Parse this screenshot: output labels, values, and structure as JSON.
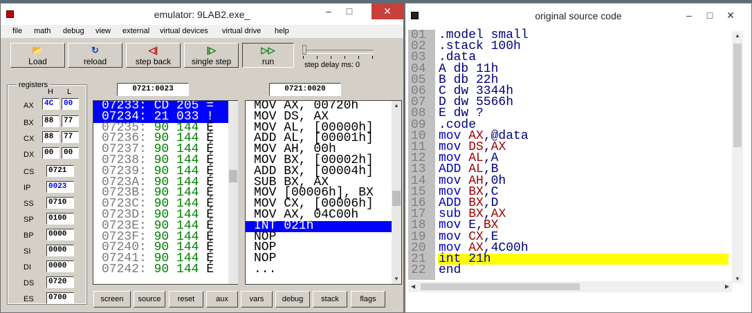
{
  "emulator": {
    "title": "emulator: 9LAB2.exe_",
    "window_controls": {
      "minimize": "–",
      "maximize": "□",
      "close": "✕"
    },
    "menu": [
      "file",
      "math",
      "debug",
      "view",
      "external",
      "virtual devices",
      "virtual drive",
      "help"
    ],
    "toolbar": {
      "buttons": [
        {
          "label": "Load",
          "icon": "folder-open-icon",
          "glyph": "📂"
        },
        {
          "label": "reload",
          "icon": "reload-icon",
          "glyph": "↻"
        },
        {
          "label": "step back",
          "icon": "step-back-icon",
          "glyph": "◁|"
        },
        {
          "label": "single step",
          "icon": "single-step-icon",
          "glyph": "|▷"
        },
        {
          "label": "run",
          "icon": "run-icon",
          "glyph": "▷▷"
        }
      ],
      "step_delay_label": "step delay ms: 0"
    },
    "registers": {
      "legend": "registers",
      "col_h": "H",
      "col_l": "L",
      "split": [
        {
          "name": "AX",
          "h": "4C",
          "l": "00"
        },
        {
          "name": "BX",
          "h": "88",
          "l": "77"
        },
        {
          "name": "CX",
          "h": "88",
          "l": "77"
        },
        {
          "name": "DX",
          "h": "00",
          "l": "00"
        }
      ],
      "full": [
        {
          "name": "CS",
          "value": "0721"
        },
        {
          "name": "IP",
          "value": "0023"
        },
        {
          "name": "SS",
          "value": "0710"
        },
        {
          "name": "SP",
          "value": "0100"
        },
        {
          "name": "BP",
          "value": "0000"
        },
        {
          "name": "SI",
          "value": "0000"
        },
        {
          "name": "DI",
          "value": "0000"
        },
        {
          "name": "DS",
          "value": "0720"
        },
        {
          "name": "ES",
          "value": "0700"
        }
      ]
    },
    "memory_address": "0721:0023",
    "disasm_address": "0721:0020",
    "memory_rows": [
      {
        "addr": "07233:",
        "hex": "CD",
        "dec": "205",
        "ch": "="
      },
      {
        "addr": "07234:",
        "hex": "21",
        "dec": "033",
        "ch": "!"
      },
      {
        "addr": "07235:",
        "hex": "90",
        "dec": "144",
        "ch": "É"
      },
      {
        "addr": "07236:",
        "hex": "90",
        "dec": "144",
        "ch": "É"
      },
      {
        "addr": "07237:",
        "hex": "90",
        "dec": "144",
        "ch": "É"
      },
      {
        "addr": "07238:",
        "hex": "90",
        "dec": "144",
        "ch": "É"
      },
      {
        "addr": "07239:",
        "hex": "90",
        "dec": "144",
        "ch": "É"
      },
      {
        "addr": "0723A:",
        "hex": "90",
        "dec": "144",
        "ch": "É"
      },
      {
        "addr": "0723B:",
        "hex": "90",
        "dec": "144",
        "ch": "É"
      },
      {
        "addr": "0723C:",
        "hex": "90",
        "dec": "144",
        "ch": "É"
      },
      {
        "addr": "0723D:",
        "hex": "90",
        "dec": "144",
        "ch": "É"
      },
      {
        "addr": "0723E:",
        "hex": "90",
        "dec": "144",
        "ch": "É"
      },
      {
        "addr": "0723F:",
        "hex": "90",
        "dec": "144",
        "ch": "É"
      },
      {
        "addr": "07240:",
        "hex": "90",
        "dec": "144",
        "ch": "É"
      },
      {
        "addr": "07241:",
        "hex": "90",
        "dec": "144",
        "ch": "É"
      },
      {
        "addr": "07242:",
        "hex": "90",
        "dec": "144",
        "ch": "É"
      }
    ],
    "disasm_rows": [
      "MOV AX, 00720h",
      "MOV DS, AX",
      "MOV AL, [00000h]",
      "ADD AL, [00001h]",
      "MOV AH, 00h",
      "MOV BX, [00002h]",
      "ADD BX, [00004h]",
      "SUB BX, AX",
      "MOV [00006h], BX",
      "MOV CX, [00006h]",
      "MOV AX, 04C00h",
      "INT 021h",
      "NOP",
      "NOP",
      "NOP",
      "..."
    ],
    "bottom_buttons": [
      "screen",
      "source",
      "reset",
      "aux",
      "vars",
      "debug",
      "stack",
      "flags"
    ]
  },
  "source": {
    "title": "original source code",
    "window_controls": {
      "minimize": "–",
      "maximize": "□",
      "close": "✕"
    },
    "lines": [
      {
        "n": "01",
        "parts": [
          {
            "t": ".model small",
            "c": "pl"
          }
        ]
      },
      {
        "n": "02",
        "parts": [
          {
            "t": ".stack 100h",
            "c": "pl"
          }
        ]
      },
      {
        "n": "03",
        "parts": [
          {
            "t": ".data",
            "c": "pl"
          }
        ]
      },
      {
        "n": "04",
        "parts": [
          {
            "t": "A db 11h",
            "c": "pl"
          }
        ]
      },
      {
        "n": "05",
        "parts": [
          {
            "t": "B db 22h",
            "c": "pl"
          }
        ]
      },
      {
        "n": "06",
        "parts": [
          {
            "t": "C dw 3344h",
            "c": "pl"
          }
        ]
      },
      {
        "n": "07",
        "parts": [
          {
            "t": "D dw 5566h",
            "c": "pl"
          }
        ]
      },
      {
        "n": "08",
        "parts": [
          {
            "t": "E dw ?",
            "c": "pl"
          }
        ]
      },
      {
        "n": "09",
        "parts": [
          {
            "t": ".code",
            "c": "pl"
          }
        ]
      },
      {
        "n": "10",
        "parts": [
          {
            "t": "mov ",
            "c": "kw"
          },
          {
            "t": "AX",
            "c": "rg"
          },
          {
            "t": ",@data",
            "c": "pl"
          }
        ]
      },
      {
        "n": "11",
        "parts": [
          {
            "t": "mov ",
            "c": "kw"
          },
          {
            "t": "DS",
            "c": "rg"
          },
          {
            "t": ",",
            "c": "pl"
          },
          {
            "t": "AX",
            "c": "rg"
          }
        ]
      },
      {
        "n": "12",
        "parts": [
          {
            "t": "mov ",
            "c": "kw"
          },
          {
            "t": "AL",
            "c": "rg"
          },
          {
            "t": ",A",
            "c": "pl"
          }
        ]
      },
      {
        "n": "13",
        "parts": [
          {
            "t": "ADD ",
            "c": "kw"
          },
          {
            "t": "AL",
            "c": "rg"
          },
          {
            "t": ",B",
            "c": "pl"
          }
        ]
      },
      {
        "n": "14",
        "parts": [
          {
            "t": "mov ",
            "c": "kw"
          },
          {
            "t": "AH",
            "c": "rg"
          },
          {
            "t": ",0h",
            "c": "pl"
          }
        ]
      },
      {
        "n": "15",
        "parts": [
          {
            "t": "mov ",
            "c": "kw"
          },
          {
            "t": "BX",
            "c": "rg"
          },
          {
            "t": ",C",
            "c": "pl"
          }
        ]
      },
      {
        "n": "16",
        "parts": [
          {
            "t": "ADD ",
            "c": "kw"
          },
          {
            "t": "BX",
            "c": "rg"
          },
          {
            "t": ",D",
            "c": "pl"
          }
        ]
      },
      {
        "n": "17",
        "parts": [
          {
            "t": "sub ",
            "c": "kw"
          },
          {
            "t": "BX",
            "c": "rg"
          },
          {
            "t": ",",
            "c": "pl"
          },
          {
            "t": "AX",
            "c": "rg"
          }
        ]
      },
      {
        "n": "18",
        "parts": [
          {
            "t": "mov ",
            "c": "kw"
          },
          {
            "t": "E",
            "c": "pl"
          },
          {
            "t": ",",
            "c": "pl"
          },
          {
            "t": "BX",
            "c": "rg"
          }
        ]
      },
      {
        "n": "19",
        "parts": [
          {
            "t": "mov ",
            "c": "kw"
          },
          {
            "t": "CX",
            "c": "rg"
          },
          {
            "t": ",E",
            "c": "pl"
          }
        ]
      },
      {
        "n": "20",
        "parts": [
          {
            "t": "mov ",
            "c": "kw"
          },
          {
            "t": "AX",
            "c": "rg"
          },
          {
            "t": ",4C00h",
            "c": "pl"
          }
        ]
      },
      {
        "n": "21",
        "parts": [
          {
            "t": "int 21h",
            "c": "kw"
          }
        ],
        "highlight": true
      },
      {
        "n": "22",
        "parts": [
          {
            "t": "end",
            "c": "pl"
          }
        ]
      }
    ]
  },
  "colors": {
    "selection": "#0000ff",
    "current_line": "#ffff00",
    "keyword": "#0000c0",
    "register": "#a00000",
    "close_button": "#c7403a"
  }
}
